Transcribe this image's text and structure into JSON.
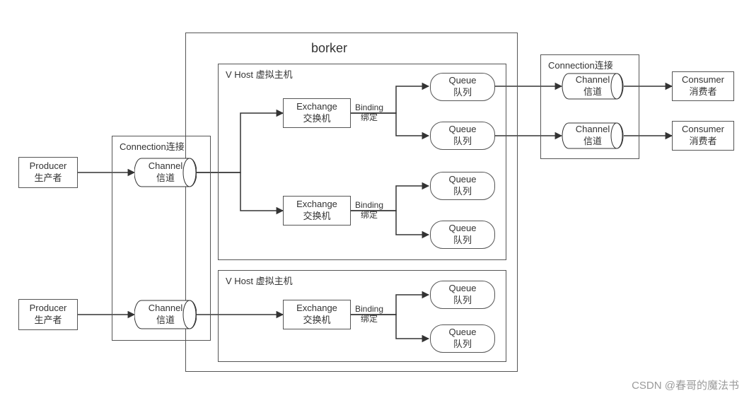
{
  "broker_title": "borker",
  "connection_left_title": "Connection连接",
  "connection_right_title": "Connection连接",
  "vhost1_title": "V Host 虚拟主机",
  "vhost2_title": "V Host 虚拟主机",
  "producer1_l1": "Producer",
  "producer1_l2": "生产者",
  "producer2_l1": "Producer",
  "producer2_l2": "生产者",
  "channel1_l1": "Channel",
  "channel1_l2": "信道",
  "channel2_l1": "Channel",
  "channel2_l2": "信道",
  "channel_r1_l1": "Channel",
  "channel_r1_l2": "信道",
  "channel_r2_l1": "Channel",
  "channel_r2_l2": "信道",
  "exchange1_l1": "Exchange",
  "exchange1_l2": "交换机",
  "exchange2_l1": "Exchange",
  "exchange2_l2": "交换机",
  "exchange3_l1": "Exchange",
  "exchange3_l2": "交换机",
  "binding1_l1": "Binding",
  "binding1_l2": "绑定",
  "binding2_l1": "Binding",
  "binding2_l2": "绑定",
  "binding3_l1": "Binding",
  "binding3_l2": "绑定",
  "queue_l1": "Queue",
  "queue_l2": "队列",
  "consumer1_l1": "Consumer",
  "consumer1_l2": "消费者",
  "consumer2_l1": "Consumer",
  "consumer2_l2": "消费者",
  "watermark": "CSDN @春哥的魔法书"
}
